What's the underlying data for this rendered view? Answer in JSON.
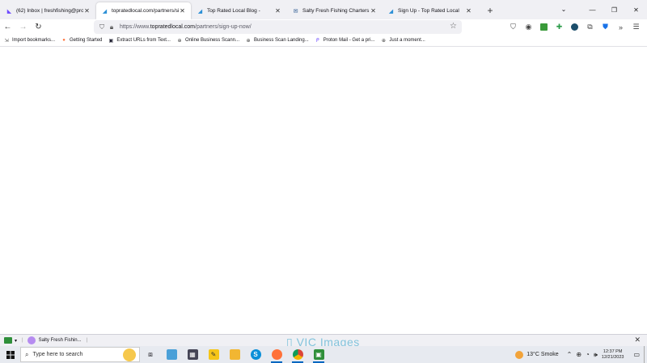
{
  "tabs": [
    {
      "title": "(62) Inbox | freshfishing@proto",
      "icon": "proton-mail-icon",
      "color": "#6d4aff",
      "active": false
    },
    {
      "title": "topratedlocal.com/partners/sig",
      "icon": "toprated-icon",
      "color": "#2a8fd6",
      "active": true
    },
    {
      "title": "Top Rated Local Blog -",
      "icon": "toprated-icon",
      "color": "#2a8fd6",
      "active": false
    },
    {
      "title": "Salty Fresh Fishing Charters - M",
      "icon": "mail-icon",
      "color": "#1d4e89",
      "active": false
    },
    {
      "title": "Sign Up - Top Rated Local",
      "icon": "toprated-icon",
      "color": "#2a8fd6",
      "active": false
    }
  ],
  "url": {
    "prefix": "https://www.",
    "host": "topratedlocal.com",
    "path": "/partners/sign-up-now/"
  },
  "bookmarks": [
    {
      "label": "Import bookmarks...",
      "icon": "import-icon"
    },
    {
      "label": "Getting Started",
      "icon": "firefox-icon"
    },
    {
      "label": "Extract URLs from Text...",
      "icon": "extract-icon"
    },
    {
      "label": "Online Business Scann...",
      "icon": "globe-icon"
    },
    {
      "label": "Business Scan Landing...",
      "icon": "globe-icon"
    },
    {
      "label": "Proton Mail - Get a pri...",
      "icon": "proton-icon"
    },
    {
      "label": "Just a moment...",
      "icon": "globe-icon"
    }
  ],
  "statusbar": {
    "item_label": "Salty Fresh Fishin...",
    "watermark": "VIC Images"
  },
  "taskbar": {
    "search_placeholder": "Type here to search",
    "weather": "13°C  Smoke",
    "time": "12:37 PM",
    "date": "12/21/2023"
  },
  "colors": {
    "accent": "#0067c0",
    "tab_strip": "#f0f0f4",
    "urlbar": "#f0f0f4"
  }
}
